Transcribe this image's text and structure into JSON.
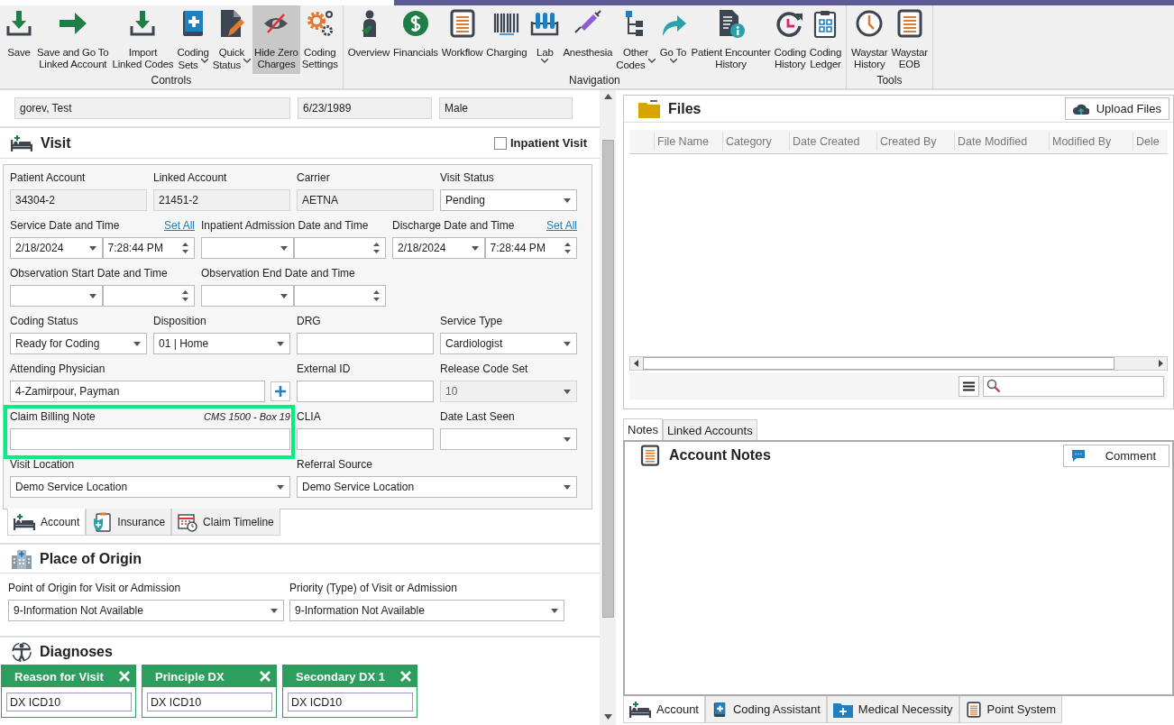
{
  "toolbar": {
    "groups": [
      {
        "label": "Controls",
        "items": [
          {
            "label": [
              "Save"
            ],
            "dropdown": false,
            "selected": false
          },
          {
            "label": [
              "Save and Go To",
              "Linked Account"
            ],
            "dropdown": false,
            "selected": false
          },
          {
            "label": [
              "Import",
              "Linked Codes"
            ],
            "dropdown": false,
            "selected": false
          },
          {
            "label": [
              "Coding",
              "Sets"
            ],
            "dropdown": true,
            "selected": false
          },
          {
            "label": [
              "Quick",
              "Status"
            ],
            "dropdown": true,
            "selected": false
          },
          {
            "label": [
              "Hide Zero",
              "Charges"
            ],
            "dropdown": false,
            "selected": true
          },
          {
            "label": [
              "Coding",
              "Settings"
            ],
            "dropdown": false,
            "selected": false
          }
        ]
      },
      {
        "label": "Navigation",
        "items": [
          {
            "label": [
              "Overview"
            ],
            "dropdown": false,
            "selected": false
          },
          {
            "label": [
              "Financials"
            ],
            "dropdown": false,
            "selected": false
          },
          {
            "label": [
              "Workflow"
            ],
            "dropdown": false,
            "selected": false
          },
          {
            "label": [
              "Charging"
            ],
            "dropdown": false,
            "selected": false
          },
          {
            "label": [
              "Lab"
            ],
            "dropdown": true,
            "selected": false
          },
          {
            "label": [
              "Anesthesia"
            ],
            "dropdown": false,
            "selected": false
          },
          {
            "label": [
              "Other",
              "Codes"
            ],
            "dropdown": true,
            "selected": false
          },
          {
            "label": [
              "Go To"
            ],
            "dropdown": true,
            "selected": false
          },
          {
            "label": [
              "Patient Encounter",
              "History"
            ],
            "dropdown": false,
            "selected": false
          },
          {
            "label": [
              "Coding",
              "History"
            ],
            "dropdown": false,
            "selected": false
          },
          {
            "label": [
              "Coding",
              "Ledger"
            ],
            "dropdown": false,
            "selected": false
          }
        ]
      },
      {
        "label": "Tools",
        "items": [
          {
            "label": [
              "Waystar",
              "History"
            ],
            "dropdown": false,
            "selected": false
          },
          {
            "label": [
              "Waystar",
              "EOB"
            ],
            "dropdown": false,
            "selected": false
          }
        ]
      }
    ]
  },
  "patient": {
    "name": "gorev, Test",
    "birth_date": "6/23/1989",
    "sex": "Male"
  },
  "visit": {
    "title": "Visit",
    "inpatient_visit": {
      "label": "Inpatient Visit",
      "checked": false
    },
    "rows": [
      [
        {
          "kind": "readonly",
          "label": "Patient Account",
          "value": "34304-2"
        },
        {
          "kind": "readonly",
          "label": "Linked Account",
          "value": "21451-2"
        },
        {
          "kind": "readonly",
          "label": "Carrier",
          "value": "AETNA"
        },
        {
          "kind": "combo",
          "label": "Visit Status",
          "value": "Pending",
          "disabled": false
        }
      ],
      [
        {
          "kind": "datetime",
          "label": "Service Date and Time",
          "link": "Set All",
          "date": "2/18/2024",
          "time": "7:28:44 PM"
        },
        {
          "kind": "datetime",
          "label": "Inpatient Admission Date and Time"
        },
        {
          "kind": "datetime",
          "label": "Discharge Date and Time",
          "link": "Set All",
          "date": "2/18/2024",
          "time": "7:28:44 PM"
        }
      ],
      [
        {
          "kind": "datetime",
          "label": "Observation Start Date and Time"
        },
        {
          "kind": "datetime",
          "label": "Observation End Date and Time"
        }
      ],
      [
        {
          "kind": "combo",
          "label": "Coding Status",
          "value": "Ready for Coding",
          "disabled": false
        },
        {
          "kind": "combo",
          "label": "Disposition",
          "value": "01 | Home",
          "disabled": false
        },
        {
          "kind": "text",
          "label": "DRG"
        },
        {
          "kind": "combo",
          "label": "Service Type",
          "value": "Cardiologist",
          "disabled": false
        }
      ],
      [
        {
          "kind": "lookup",
          "label": "Attending Physician",
          "value": "4-Zamirpour, Payman"
        },
        {
          "kind": "text",
          "label": "External ID"
        },
        {
          "kind": "combo",
          "label": "Release Code Set",
          "value": "10",
          "disabled": true
        }
      ],
      [
        {
          "kind": "note",
          "label": "Claim Billing Note",
          "hint": "CMS 1500 - Box 19",
          "highlighted": true
        },
        {
          "kind": "text",
          "label": "CLIA"
        },
        {
          "kind": "combo",
          "label": "Date Last Seen",
          "disabled": false
        }
      ],
      [
        {
          "kind": "combo",
          "label": "Visit Location",
          "value": "Demo Service Location",
          "disabled": false
        },
        {
          "kind": "combo",
          "label": "Referral Source",
          "value": "Demo Service Location",
          "disabled": false
        }
      ]
    ],
    "tabs": [
      {
        "label": "Account",
        "selected": true
      },
      {
        "label": "Insurance",
        "selected": false
      },
      {
        "label": "Claim Timeline",
        "selected": false
      }
    ]
  },
  "place_of_origin": {
    "title": "Place of Origin",
    "fields": [
      {
        "label": "Point of Origin for Visit or Admission",
        "value": "9-Information Not Available"
      },
      {
        "label": "Priority (Type) of Visit or Admission",
        "value": "9-Information Not Available"
      }
    ]
  },
  "diagnoses": {
    "title": "Diagnoses",
    "cards": [
      {
        "title": "Reason for Visit",
        "value": "DX ICD10"
      },
      {
        "title": "Principle DX",
        "value": "DX ICD10"
      },
      {
        "title": "Secondary DX 1",
        "value": "DX ICD10"
      }
    ]
  },
  "files": {
    "title": "Files",
    "upload_button": "Upload Files",
    "columns": [
      "File Name",
      "Category",
      "Date Created",
      "Created By",
      "Date Modified",
      "Modified By",
      "Dele"
    ]
  },
  "notes_tabs": [
    {
      "label": "Notes",
      "selected": true
    },
    {
      "label": "Linked Accounts",
      "selected": false
    }
  ],
  "account_notes": {
    "title": "Account Notes",
    "comment_button": "Comment"
  },
  "bottom_tabs": [
    {
      "label": "Account",
      "selected": true
    },
    {
      "label": "Coding Assistant",
      "selected": false
    },
    {
      "label": "Medical Necessity",
      "selected": false
    },
    {
      "label": "Point System",
      "selected": false
    }
  ]
}
